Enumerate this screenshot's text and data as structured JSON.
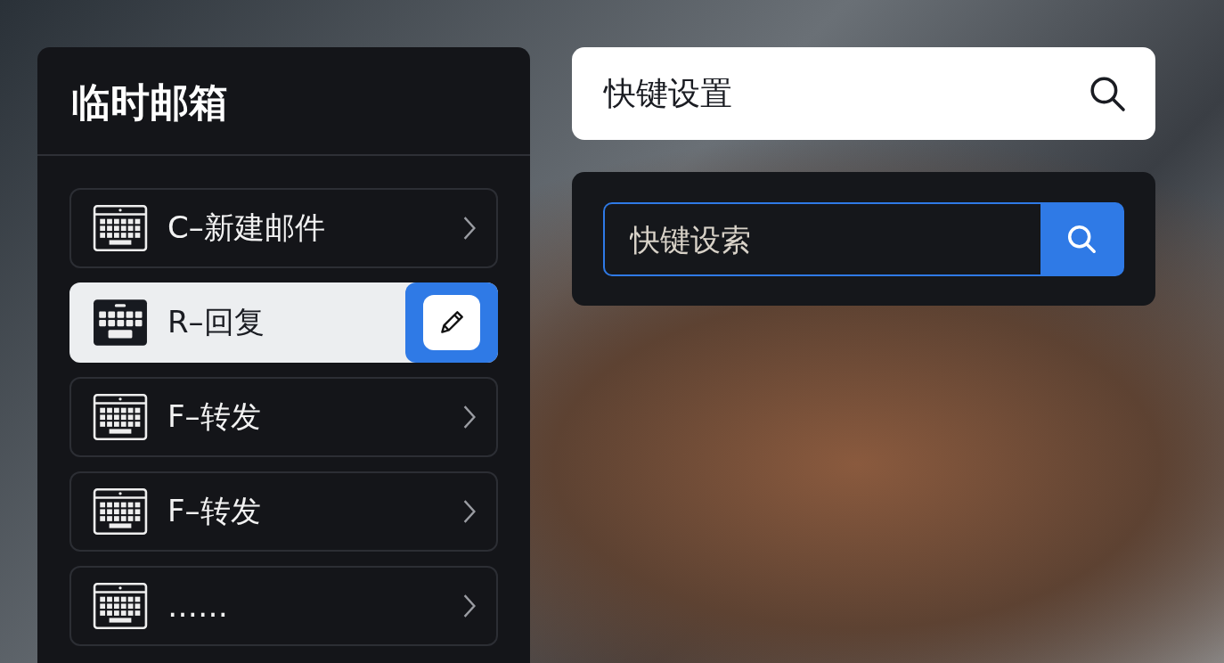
{
  "panel": {
    "title": "临时邮箱"
  },
  "shortcuts": [
    {
      "label": "C–新建邮件",
      "selected": false
    },
    {
      "label": "R–回复",
      "selected": true
    },
    {
      "label": "F–转发",
      "selected": false
    },
    {
      "label": "F–转发",
      "selected": false
    },
    {
      "label": "……",
      "selected": false
    }
  ],
  "top_search": {
    "value": "快键设置"
  },
  "search_card": {
    "placeholder": "快键设索"
  }
}
